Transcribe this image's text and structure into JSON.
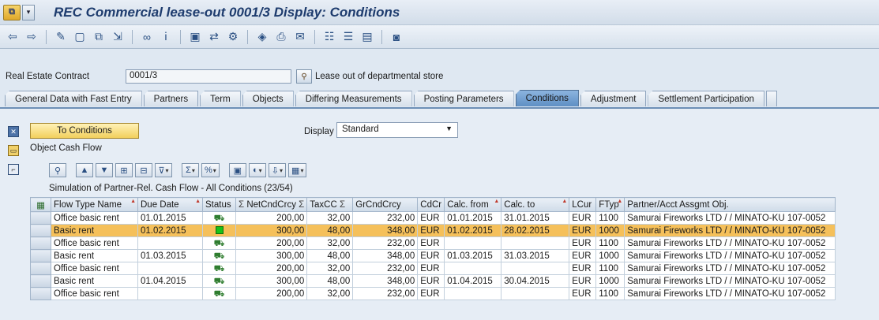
{
  "window": {
    "title": "REC Commercial lease-out 0001/3 Display: Conditions",
    "sysmenu_icon": "sap-logo-icon"
  },
  "header": {
    "contract_label": "Real Estate Contract",
    "contract_value": "0001/3",
    "contract_description": "Lease out of departmental store"
  },
  "tabs": [
    "General Data with Fast Entry",
    "Partners",
    "Term",
    "Objects",
    "Differing Measurements",
    "Posting Parameters",
    "Conditions",
    "Adjustment",
    "Settlement Participation"
  ],
  "active_tab": "Conditions",
  "conditions": {
    "to_conditions_button": "To Conditions",
    "display_label": "Display",
    "display_value": "Standard",
    "object_cash_flow": "Object Cash Flow"
  },
  "grid": {
    "title": "Simulation of Partner-Rel. Cash Flow - All Conditions (23/54)",
    "columns": [
      "Flow Type Name",
      "Due Date",
      "Status",
      "NetCndCrcy",
      "TaxCC",
      "GrCndCrcy",
      "CdCr",
      "Calc. from",
      "Calc. to",
      "LCur",
      "FTyp",
      "Partner/Acct Assgmt Obj."
    ],
    "sum_marker": "Σ",
    "rows": [
      {
        "flow": "Office basic rent",
        "due": "01.01.2015",
        "status": "posted",
        "net": "200,00",
        "tax": "32,00",
        "gross": "232,00",
        "cdcr": "EUR",
        "from": "01.01.2015",
        "to": "31.01.2015",
        "lcur": "EUR",
        "ftyp": "1100",
        "partner": "Samurai Fireworks LTD / / MINATO-KU 107-0052"
      },
      {
        "flow": "Basic rent",
        "due": "01.02.2015",
        "status": "open",
        "net": "300,00",
        "tax": "48,00",
        "gross": "348,00",
        "cdcr": "EUR",
        "from": "01.02.2015",
        "to": "28.02.2015",
        "lcur": "EUR",
        "ftyp": "1000",
        "partner": "Samurai Fireworks LTD / / MINATO-KU 107-0052"
      },
      {
        "flow": "Office basic rent",
        "due": "",
        "status": "posted",
        "net": "200,00",
        "tax": "32,00",
        "gross": "232,00",
        "cdcr": "EUR",
        "from": "",
        "to": "",
        "lcur": "EUR",
        "ftyp": "1100",
        "partner": "Samurai Fireworks LTD / / MINATO-KU 107-0052"
      },
      {
        "flow": "Basic rent",
        "due": "01.03.2015",
        "status": "posted",
        "net": "300,00",
        "tax": "48,00",
        "gross": "348,00",
        "cdcr": "EUR",
        "from": "01.03.2015",
        "to": "31.03.2015",
        "lcur": "EUR",
        "ftyp": "1000",
        "partner": "Samurai Fireworks LTD / / MINATO-KU 107-0052"
      },
      {
        "flow": "Office basic rent",
        "due": "",
        "status": "posted",
        "net": "200,00",
        "tax": "32,00",
        "gross": "232,00",
        "cdcr": "EUR",
        "from": "",
        "to": "",
        "lcur": "EUR",
        "ftyp": "1100",
        "partner": "Samurai Fireworks LTD / / MINATO-KU 107-0052"
      },
      {
        "flow": "Basic rent",
        "due": "01.04.2015",
        "status": "posted",
        "net": "300,00",
        "tax": "48,00",
        "gross": "348,00",
        "cdcr": "EUR",
        "from": "01.04.2015",
        "to": "30.04.2015",
        "lcur": "EUR",
        "ftyp": "1000",
        "partner": "Samurai Fireworks LTD / / MINATO-KU 107-0052"
      },
      {
        "flow": "Office basic rent",
        "due": "",
        "status": "posted",
        "net": "200,00",
        "tax": "32,00",
        "gross": "232,00",
        "cdcr": "EUR",
        "from": "",
        "to": "",
        "lcur": "EUR",
        "ftyp": "1100",
        "partner": "Samurai Fireworks LTD / / MINATO-KU 107-0052"
      }
    ],
    "selected_row": 1
  },
  "colors": {
    "selected_row": "#f5c05a",
    "active_tab": "#6e9bcc",
    "title_text": "#1e3c6e"
  }
}
